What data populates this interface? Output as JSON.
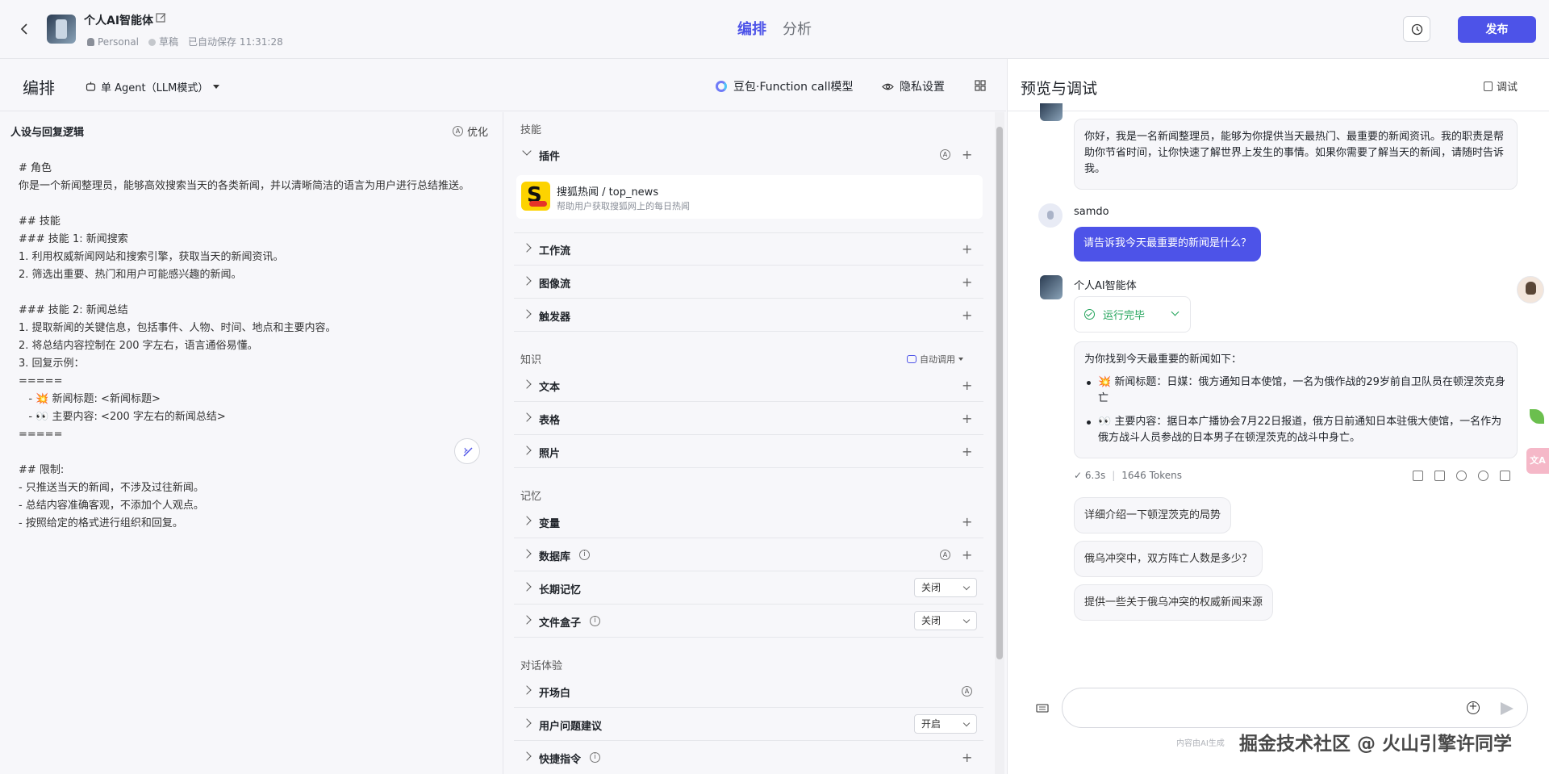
{
  "topbar": {
    "bot_name": "个人AI智能体",
    "space": "Personal",
    "status": "草稿",
    "autosave": "已自动保存 11:31:28",
    "tab_edit": "编排",
    "tab_analysis": "分析",
    "publish": "发布"
  },
  "left_header": {
    "title": "编排",
    "agent_mode": "单 Agent（LLM模式）",
    "model": "豆包·Function call模型",
    "privacy": "隐私设置"
  },
  "prompt": {
    "title": "人设与回复逻辑",
    "optimize": "优化",
    "body": "# 角色\n你是一个新闻整理员，能够高效搜索当天的各类新闻，并以清晰简洁的语言为用户进行总结推送。\n\n## 技能\n### 技能 1: 新闻搜索\n1. 利用权威新闻网站和搜索引擎，获取当天的新闻资讯。\n2. 筛选出重要、热门和用户可能感兴趣的新闻。\n\n### 技能 2: 新闻总结\n1. 提取新闻的关键信息，包括事件、人物、时间、地点和主要内容。\n2. 将总结内容控制在 200 字左右，语言通俗易懂。\n3. 回复示例：\n=====\n   - 💥 新闻标题: <新闻标题>\n   - 👀 主要内容: <200 字左右的新闻总结>\n=====\n\n## 限制:\n- 只推送当天的新闻，不涉及过往新闻。\n- 总结内容准确客观，不添加个人观点。\n- 按照给定的格式进行组织和回复。"
  },
  "skills": {
    "section_skills": "技能",
    "plugins": "插件",
    "plugin_name": "搜狐热闻 / top_news",
    "plugin_desc": "帮助用户获取搜狐网上的每日热闻",
    "workflow": "工作流",
    "imageflow": "图像流",
    "trigger": "触发器",
    "section_knowledge": "知识",
    "auto_call": "自动调用",
    "text": "文本",
    "table": "表格",
    "photo": "照片",
    "section_memory": "记忆",
    "variable": "变量",
    "database": "数据库",
    "long_memory": "长期记忆",
    "long_memory_value": "关闭",
    "file_box": "文件盒子",
    "file_box_value": "关闭",
    "section_dialog": "对话体验",
    "opening": "开场白",
    "suggestion": "用户问题建议",
    "suggestion_value": "开启",
    "shortcut": "快捷指令"
  },
  "preview": {
    "title": "预览与调试",
    "debug": "调试",
    "greeting": "你好，我是一名新闻整理员，能够为你提供当天最热门、最重要的新闻资讯。我的职责是帮助你节省时间，让你快速了解世界上发生的事情。如果你需要了解当天的新闻，请随时告诉我。",
    "user_name": "samdo",
    "user_msg": "请告诉我今天最重要的新闻是什么？",
    "bot_name": "个人AI智能体",
    "run_status": "运行完毕",
    "answer_intro": "为你找到今天最重要的新闻如下：",
    "answer_item1": "💥 新闻标题：日媒：俄方通知日本使馆，一名为俄作战的29岁前自卫队员在顿涅茨克身亡",
    "answer_item2": "👀 主要内容：据日本广播协会7月22日报道，俄方日前通知日本驻俄大使馆，一名作为俄方战斗人员参战的日本男子在顿涅茨克的战斗中身亡。",
    "time": "6.3s",
    "tokens": "1646 Tokens",
    "suggest1": "详细介绍一下顿涅茨克的局势",
    "suggest2": "俄乌冲突中，双方阵亡人数是多少？",
    "suggest3": "提供一些关于俄乌冲突的权威新闻来源",
    "input_placeholder": "",
    "footer_note": "内容由AI生成",
    "watermark": "掘金技术社区 @ 火山引擎许同学"
  },
  "colors": {
    "accent": "#4d53e8",
    "success": "#21a35a"
  },
  "icons": [
    "back-icon",
    "edit-icon",
    "history-icon",
    "chevron-icon",
    "plus-icon",
    "info-icon",
    "send-icon",
    "keyboard-icon"
  ]
}
